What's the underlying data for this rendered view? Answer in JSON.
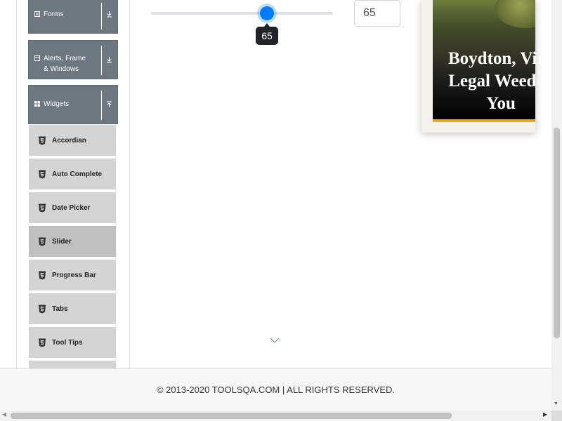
{
  "sidebar": {
    "groups": [
      {
        "label": "Forms",
        "icon": "form-icon",
        "toggle": "expand"
      },
      {
        "label": "Alerts, Frame & Windows",
        "icon": "window-icon",
        "toggle": "expand"
      },
      {
        "label": "Widgets",
        "icon": "grid-icon",
        "toggle": "collapse"
      }
    ],
    "widget_items": [
      {
        "label": "Accordian"
      },
      {
        "label": "Auto Complete"
      },
      {
        "label": "Date Picker"
      },
      {
        "label": "Slider",
        "active": true
      },
      {
        "label": "Progress Bar"
      },
      {
        "label": "Tabs"
      },
      {
        "label": "Tool Tips"
      }
    ]
  },
  "slider": {
    "value": "65",
    "tooltip": "65",
    "min": 0,
    "max": 100,
    "level": 65,
    "accent": "#007bff"
  },
  "ad": {
    "line1": "Boydton, Virg",
    "line2": "Legal Weed D",
    "line3": "You"
  },
  "footer": {
    "text": "© 2013-2020 TOOLSQA.COM | ALL RIGHTS RESERVED."
  },
  "icons": {
    "html5": "html5-icon",
    "scroll_down": "chevron-down-icon"
  }
}
